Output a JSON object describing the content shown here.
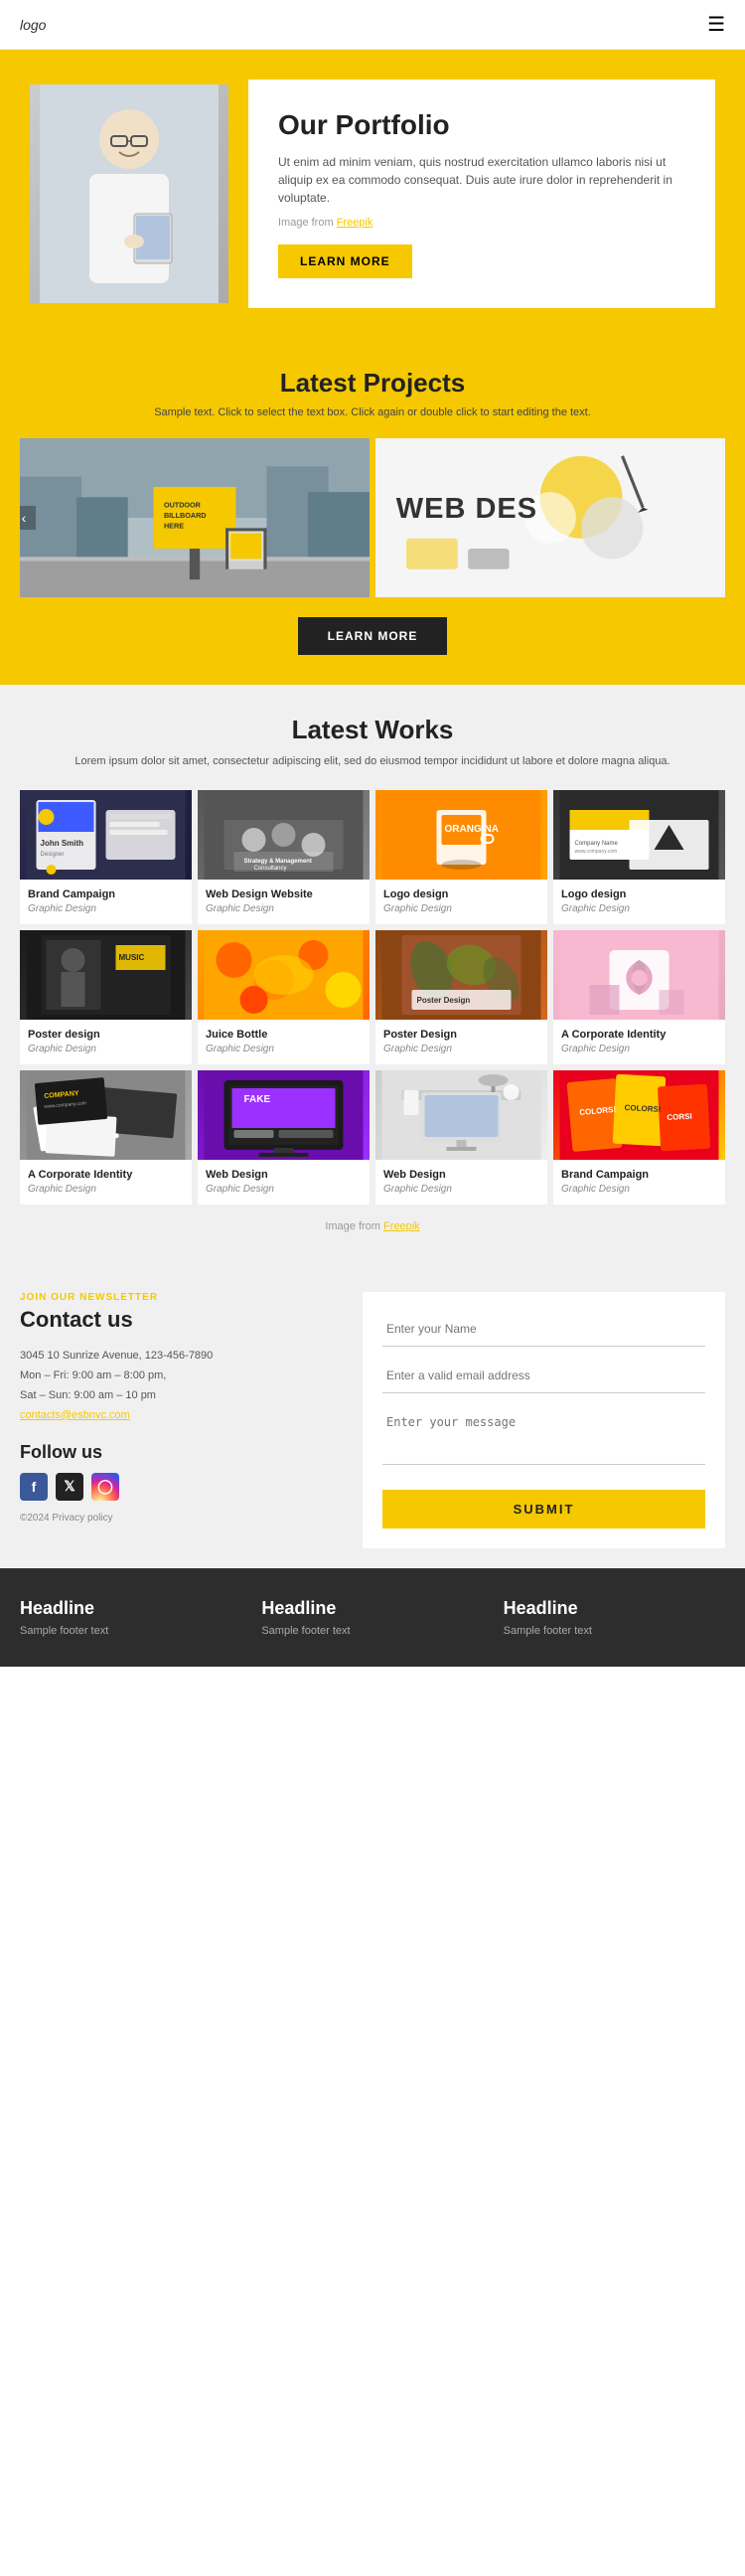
{
  "header": {
    "logo": "logo",
    "hamburger": "☰"
  },
  "hero": {
    "title": "Our Portfolio",
    "text": "Ut enim ad minim veniam, quis nostrud exercitation ullamco laboris nisi ut aliquip ex ea commodo consequat. Duis aute irure dolor in reprehenderit in voluptate.",
    "freepik_prefix": "Image from ",
    "freepik_link": "Freepik",
    "cta_label": "LEARN MORE"
  },
  "latest_projects": {
    "title": "Latest Projects",
    "subtitle": "Sample text. Click to select the text box. Click again or double click to start editing the text.",
    "slide1_label": "OUTDOOR BILLBOARD HERE",
    "slide2_label": "WEB DES",
    "cta_label": "LEARN MORE"
  },
  "latest_works": {
    "title": "Latest Works",
    "subtitle": "Lorem ipsum dolor sit amet, consectetur adipiscing elit, sed do eiusmod tempor incididunt ut labore et dolore magna aliqua.",
    "freepik_prefix": "Image from ",
    "freepik_link": "Freepik",
    "items": [
      {
        "title": "Brand Campaign",
        "category": "Graphic Design",
        "thumb": "thumb-brand-campaign",
        "icon": "🎨"
      },
      {
        "title": "Web Design Website",
        "category": "Graphic Design",
        "thumb": "thumb-web-design-site",
        "icon": "💼"
      },
      {
        "title": "Logo design",
        "category": "Graphic Design",
        "thumb": "thumb-logo-orange",
        "icon": "☕"
      },
      {
        "title": "Logo design",
        "category": "Graphic Design",
        "thumb": "thumb-logo-black",
        "icon": "△"
      },
      {
        "title": "Poster design",
        "category": "Graphic Design",
        "thumb": "thumb-poster-music",
        "icon": "🎵"
      },
      {
        "title": "Juice Bottle",
        "category": "Graphic Design",
        "thumb": "thumb-juice-bottle",
        "icon": "🍊"
      },
      {
        "title": "Poster Design",
        "category": "Graphic Design",
        "thumb": "thumb-poster-design",
        "icon": "🌿"
      },
      {
        "title": "A Corporate Identity",
        "category": "Graphic Design",
        "thumb": "thumb-corporate-pink",
        "icon": "✉"
      },
      {
        "title": "A Corporate Identity",
        "category": "Graphic Design",
        "thumb": "thumb-corporate-biz",
        "icon": "💳"
      },
      {
        "title": "Web Design",
        "category": "Graphic Design",
        "thumb": "thumb-web-fake",
        "icon": "🖥"
      },
      {
        "title": "Web Design",
        "category": "Graphic Design",
        "thumb": "thumb-web-desk",
        "icon": "💡"
      },
      {
        "title": "Brand Campaign",
        "category": "Graphic Design",
        "thumb": "thumb-brand-colors",
        "icon": "🎨"
      }
    ]
  },
  "contact": {
    "newsletter_label": "JOIN OUR NEWSLETTER",
    "heading": "Contact us",
    "address": "3045 10 Sunrize Avenue, 123-456-7890",
    "hours1": "Mon – Fri: 9:00 am – 8:00 pm,",
    "hours2": "Sat – Sun: 9:00 am – 10 pm",
    "email_text": "contacts@esbnyc.com",
    "follow_heading": "Follow us",
    "copyright": "©2024 Privacy policy",
    "form": {
      "name_placeholder": "Enter your Name",
      "email_placeholder": "Enter a valid email address",
      "message_placeholder": "Enter your message",
      "submit_label": "SUBMIT"
    }
  },
  "footer": {
    "cols": [
      {
        "title": "Headline",
        "text": "Sample footer text"
      },
      {
        "title": "Headline",
        "text": "Sample footer text"
      },
      {
        "title": "Headline",
        "text": "Sample footer text"
      }
    ]
  }
}
